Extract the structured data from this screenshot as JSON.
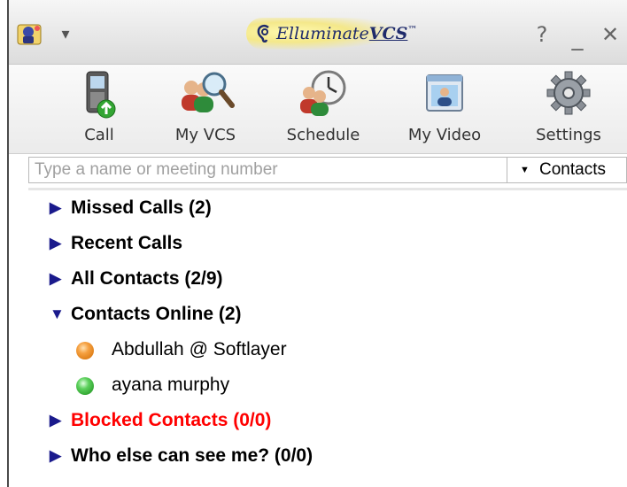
{
  "title_bar": {
    "brand_name": "Elluminate",
    "brand_suffix": "VCS",
    "brand_trademark": "™",
    "help_label": "?",
    "minimize_label": "_",
    "close_label": "✕",
    "menu_label": "▾"
  },
  "toolbar": {
    "items": [
      {
        "label": "Call",
        "icon": "phone-call-icon"
      },
      {
        "label": "My VCS",
        "icon": "people-search-icon"
      },
      {
        "label": "Schedule",
        "icon": "people-clock-icon"
      },
      {
        "label": "My Video",
        "icon": "video-window-icon"
      },
      {
        "label": "Settings",
        "icon": "gear-icon"
      }
    ]
  },
  "search": {
    "placeholder": "Type a name or meeting number",
    "value": "",
    "filter": {
      "selected": "Contacts",
      "arrow": "▼"
    }
  },
  "tree": {
    "groups": [
      {
        "label": "Missed Calls (2)",
        "expanded": false
      },
      {
        "label": "Recent Calls",
        "expanded": false
      },
      {
        "label": "All Contacts (2/9)",
        "expanded": false
      },
      {
        "label": "Contacts Online (2)",
        "expanded": true,
        "contacts": [
          {
            "name": "Abdullah @ Softlayer",
            "status": "away",
            "status_color": "#f08a1c"
          },
          {
            "name": "ayana murphy",
            "status": "online",
            "status_color": "#2fb52f"
          }
        ]
      },
      {
        "label": "Blocked Contacts (0/0)",
        "expanded": false,
        "color": "#ff0000"
      },
      {
        "label": "Who else can see me? (0/0)",
        "expanded": false
      }
    ],
    "collapsed_glyph": "▶",
    "expanded_glyph": "▼",
    "arrow_color": "#1a1a8c"
  }
}
